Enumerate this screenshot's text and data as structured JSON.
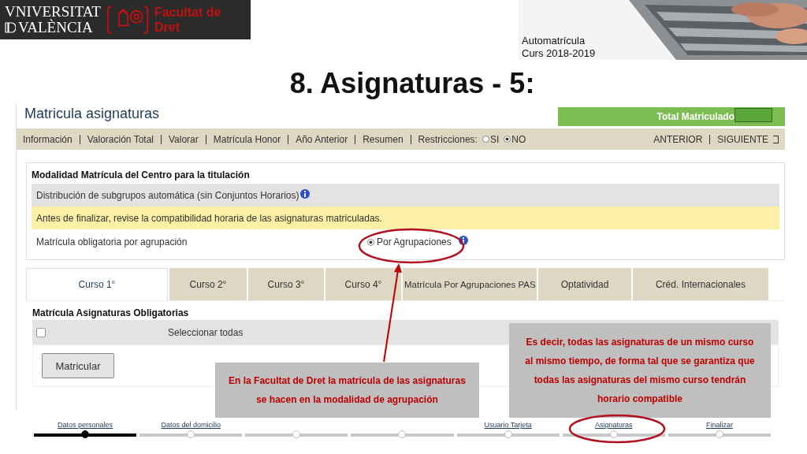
{
  "header": {
    "logo": {
      "line_1": "VNIVERSITAT",
      "line_2": "VALÈNCIA",
      "faculty_lines": [
        "Facultat de",
        "Dret"
      ]
    },
    "course_info": [
      "Automatrícula",
      "Curs 2018-2019"
    ]
  },
  "slide_title": "8. Asignaturas - 5:",
  "app": {
    "title": "Matricula asignaturas",
    "total_label": "Total Matriculado",
    "toolbar": {
      "items": [
        "Información",
        "Valoración Total",
        "Valorar",
        "Matrícula Honor",
        "Año Anterior",
        "Resumen"
      ],
      "restrictions_label": "Restricciones:",
      "restrictions": [
        {
          "label": "SI",
          "selected": false
        },
        {
          "label": "NO",
          "selected": true
        }
      ],
      "nav": [
        "ANTERIOR",
        "SIGUIENTE"
      ]
    },
    "panel": {
      "title": "Modalidad Matrícula del Centro para la titulación",
      "rows": [
        {
          "kind": "info",
          "text": "Distribución de subgrupos automática (sin Conjuntos Horarios)"
        },
        {
          "kind": "warning",
          "text": "Antes de finalizar, revise la compatibilidad horaria de las asignaturas matriculadas."
        },
        {
          "kind": "option",
          "text": "Matrícula obligatoria por agrupación",
          "option": {
            "label": "Por Agrupaciones",
            "selected": true
          }
        }
      ]
    },
    "tabs": [
      {
        "label": "Curso 1°",
        "selected": true
      },
      {
        "label": "Curso 2°",
        "selected": false
      },
      {
        "label": "Curso 3°",
        "selected": false
      },
      {
        "label": "Curso 4°",
        "selected": false
      },
      {
        "label": "Matrícula Por Agrupaciones PAS",
        "selected": false
      },
      {
        "label": "Optatividad",
        "selected": false
      },
      {
        "label": "Créd. Internacionales",
        "selected": false
      }
    ],
    "section": {
      "title": "Matrícula Asignaturas Obligatorias",
      "select_all": {
        "label": "Seleccionar todas",
        "checked": false
      },
      "button": "Matricular"
    }
  },
  "callouts": [
    {
      "text": "En la Facultat de Dret la matrícula de las asignaturas se hacen en la modalidad de agrupación"
    },
    {
      "text": "Es decir, todas las asignaturas de un mismo curso al mismo tiempo, de forma tal que se garantiza que todas las asignaturas del mismo curso tendrán horario compatible"
    }
  ],
  "steps": [
    {
      "label": "Datos personales",
      "selected": true
    },
    {
      "label": "Datos del domicilio",
      "selected": false
    },
    {
      "selected": false
    },
    {
      "selected": false
    },
    {
      "label": "Usuario Tarjeta",
      "selected": false
    },
    {
      "label": "Asignaturas",
      "selected": false
    },
    {
      "label": "Finalizar",
      "selected": false
    }
  ]
}
